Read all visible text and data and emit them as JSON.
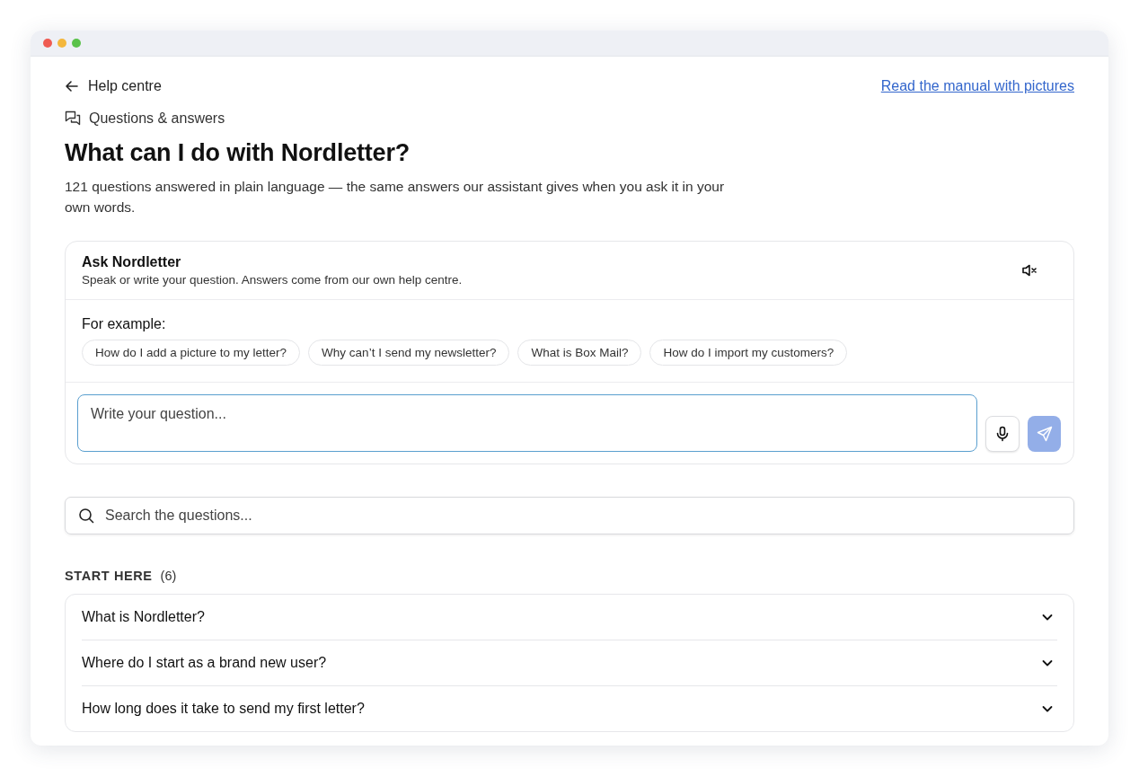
{
  "back_link": "Help centre",
  "manual_link": "Read the manual with pictures",
  "section_label": "Questions & answers",
  "title": "What can I do with Nordletter?",
  "intro": "121 questions answered in plain language — the same answers our assistant gives when you ask it in your own words.",
  "assistant": {
    "title": "Ask Nordletter",
    "subtitle": "Speak or write your question. Answers come from our own help centre.",
    "muted": true,
    "examples_label": "For example:",
    "examples": [
      "How do I add a picture to my letter?",
      "Why can’t I send my newsletter?",
      "What is Box Mail?",
      "How do I import my customers?"
    ],
    "placeholder": "Write your question...",
    "send_disabled": true
  },
  "search": {
    "placeholder": "Search the questions..."
  },
  "group": {
    "title": "START HERE",
    "count": "(6)",
    "questions": [
      {
        "text": "What is Nordletter?",
        "expanded": false
      },
      {
        "text": "Where do I start as a brand new user?",
        "expanded": false
      },
      {
        "text": "How long does it take to send my first letter?",
        "expanded": false
      }
    ]
  }
}
